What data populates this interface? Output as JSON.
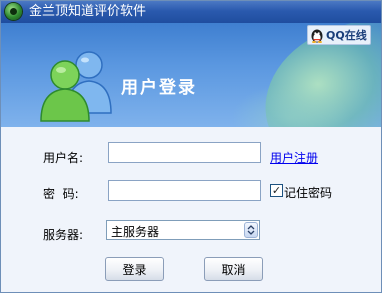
{
  "window": {
    "title": "金兰顶知道评价软件"
  },
  "banner": {
    "title": "用户登录",
    "qq_online_label": "QQ在线"
  },
  "form": {
    "username_label": "用户名:",
    "username_value": "",
    "register_link": "用户注册",
    "password_label": "密  码:",
    "password_value": "",
    "remember_label": "记住密码",
    "remember_checked": true,
    "remember_mark": "✓",
    "server_label": "服务器:",
    "server_selected": "主服务器"
  },
  "buttons": {
    "login": "登录",
    "cancel": "取消"
  },
  "colors": {
    "titlebar": "#2a5aae",
    "banner": "#5a97e0",
    "link": "#0000ee",
    "form_bg": "#f0f4fb"
  }
}
